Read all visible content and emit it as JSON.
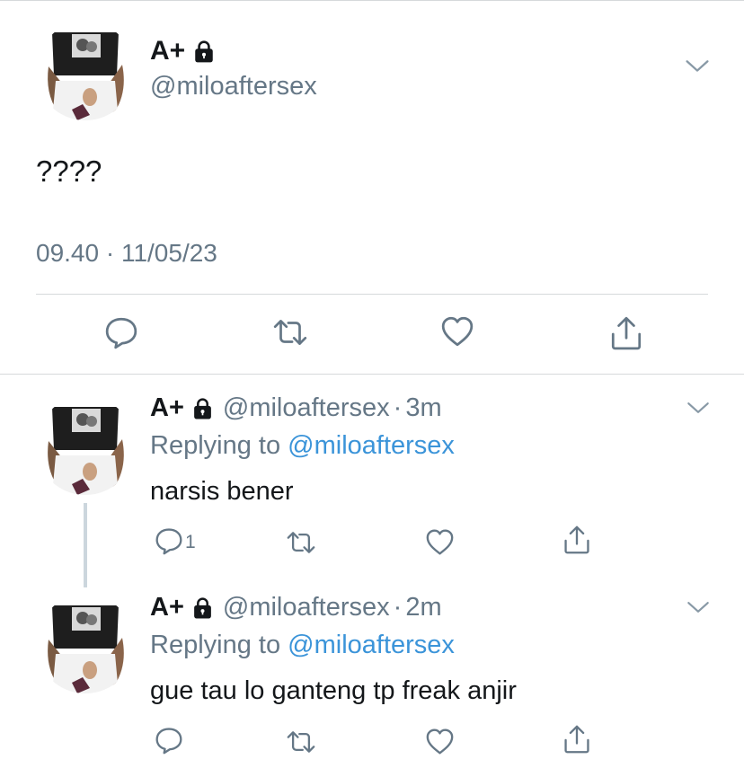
{
  "main_tweet": {
    "display_name": "A+",
    "protected_icon": "lock-icon",
    "handle": "@miloaftersex",
    "text": "????",
    "timestamp": "09.40 · 11/05/23",
    "actions": [
      "reply-icon",
      "retweet-icon",
      "like-icon",
      "share-icon"
    ]
  },
  "replies": [
    {
      "display_name": "A+",
      "handle": "@miloaftersex",
      "separator": "·",
      "time": "3m",
      "replying_prefix": "Replying to ",
      "replying_handle": "@miloaftersex",
      "text": "narsis bener",
      "reply_count": "1"
    },
    {
      "display_name": "A+",
      "handle": "@miloaftersex",
      "separator": "·",
      "time": "2m",
      "replying_prefix": "Replying to ",
      "replying_handle": "@miloaftersex",
      "text": "gue tau lo ganteng tp freak anjir",
      "reply_count": ""
    }
  ],
  "colors": {
    "text": "#14171a",
    "secondary": "#657786",
    "link": "#3b94d9",
    "divider": "#d6d9db",
    "icon": "#657786"
  }
}
